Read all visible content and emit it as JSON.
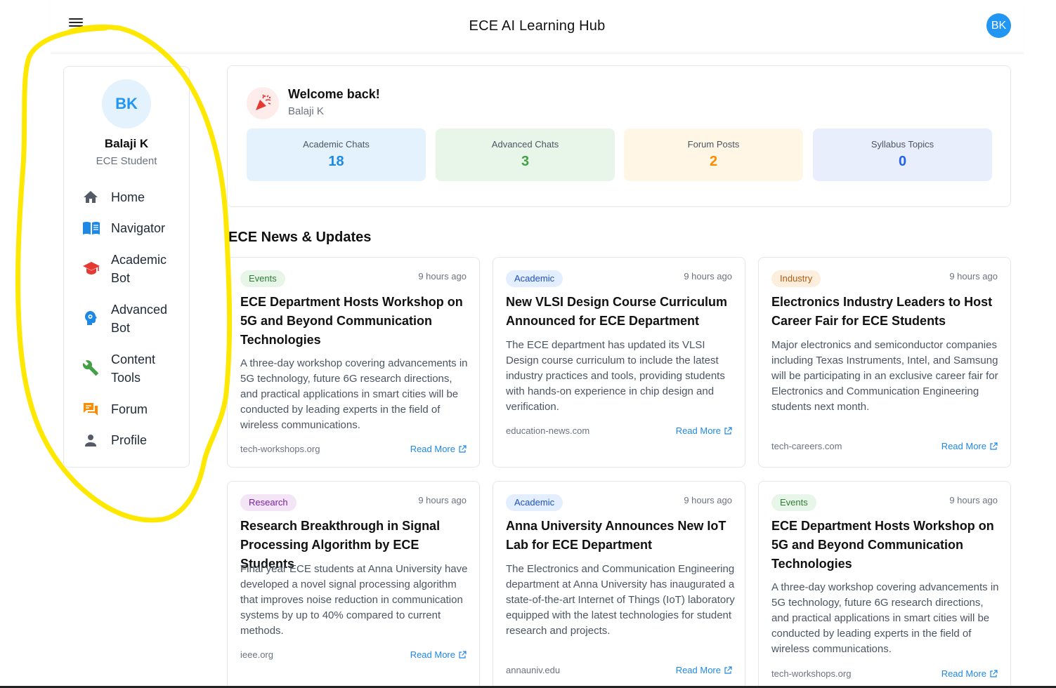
{
  "header": {
    "title": "ECE AI Learning Hub",
    "avatar_initials": "BK"
  },
  "sidebar": {
    "avatar_initials": "BK",
    "user_name": "Balaji K",
    "user_role": "ECE Student",
    "items": [
      {
        "label": "Home",
        "icon": "home-icon"
      },
      {
        "label": "Navigator",
        "icon": "book-icon"
      },
      {
        "label": "Academic\nBot",
        "icon": "graduation-cap-icon"
      },
      {
        "label": "Advanced\nBot",
        "icon": "ai-bot-icon"
      },
      {
        "label": "Content\nTools",
        "icon": "wrench-icon"
      },
      {
        "label": "Forum",
        "icon": "forum-icon"
      },
      {
        "label": "Profile",
        "icon": "person-icon"
      }
    ]
  },
  "welcome": {
    "title": "Welcome back!",
    "user": "Balaji K",
    "stats": [
      {
        "label": "Academic Chats",
        "value": "18"
      },
      {
        "label": "Advanced Chats",
        "value": "3"
      },
      {
        "label": "Forum Posts",
        "value": "2"
      },
      {
        "label": "Syllabus Topics",
        "value": "0"
      }
    ]
  },
  "news": {
    "section_title": "ECE News & Updates",
    "read_more_label": "Read More",
    "cards": [
      {
        "tag": "Events",
        "time": "9 hours ago",
        "title": "ECE Department Hosts Workshop on 5G and Beyond Communication Technologies",
        "description": "A three-day workshop covering advancements in 5G technology, future 6G research directions, and practical applications in smart cities will be conducted by leading experts in the field of wireless communications.",
        "source": "tech-workshops.org"
      },
      {
        "tag": "Academic",
        "time": "9 hours ago",
        "title": "New VLSI Design Course Curriculum Announced for ECE Department",
        "description": "The ECE department has updated its VLSI Design course curriculum to include the latest industry practices and tools, providing students with hands-on experience in chip design and verification.",
        "source": "education-news.com"
      },
      {
        "tag": "Industry",
        "time": "9 hours ago",
        "title": "Electronics Industry Leaders to Host Career Fair for ECE Students",
        "description": "Major electronics and semiconductor companies including Texas Instruments, Intel, and Samsung will be participating in an exclusive career fair for Electronics and Communication Engineering students next month.",
        "source": "tech-careers.com"
      },
      {
        "tag": "Research",
        "time": "9 hours ago",
        "title": "Research Breakthrough in Signal Processing Algorithm by ECE Students",
        "description": "Final year ECE students at Anna University have developed a novel signal processing algorithm that improves noise reduction in communication systems by up to 40% compared to current methods.",
        "source": "ieee.org"
      },
      {
        "tag": "Academic",
        "time": "9 hours ago",
        "title": "Anna University Announces New IoT Lab for ECE Department",
        "description": "The Electronics and Communication Engineering department at Anna University has inaugurated a state-of-the-art Internet of Things (IoT) laboratory equipped with the latest technologies for student research and projects.",
        "source": "annauniv.edu"
      },
      {
        "tag": "Events",
        "time": "9 hours ago",
        "title": "ECE Department Hosts Workshop on 5G and Beyond Communication Technologies",
        "description": "A three-day workshop covering advancements in 5G technology, future 6G research directions, and practical applications in smart cities will be conducted by leading experts in the field of wireless communications.",
        "source": "tech-workshops.org"
      }
    ]
  },
  "colors": {
    "primary": "#2196f3",
    "annotation": "#ffe800",
    "stat_academic_bg": "#e3f2fd",
    "stat_academic_fg": "#1e88e5",
    "stat_advanced_bg": "#e8f5e9",
    "stat_advanced_fg": "#43a047",
    "stat_forum_bg": "#fff6e5",
    "stat_forum_fg": "#fb8c00",
    "stat_syllabus_bg": "#e8eefb",
    "stat_syllabus_fg": "#1e63e9"
  }
}
